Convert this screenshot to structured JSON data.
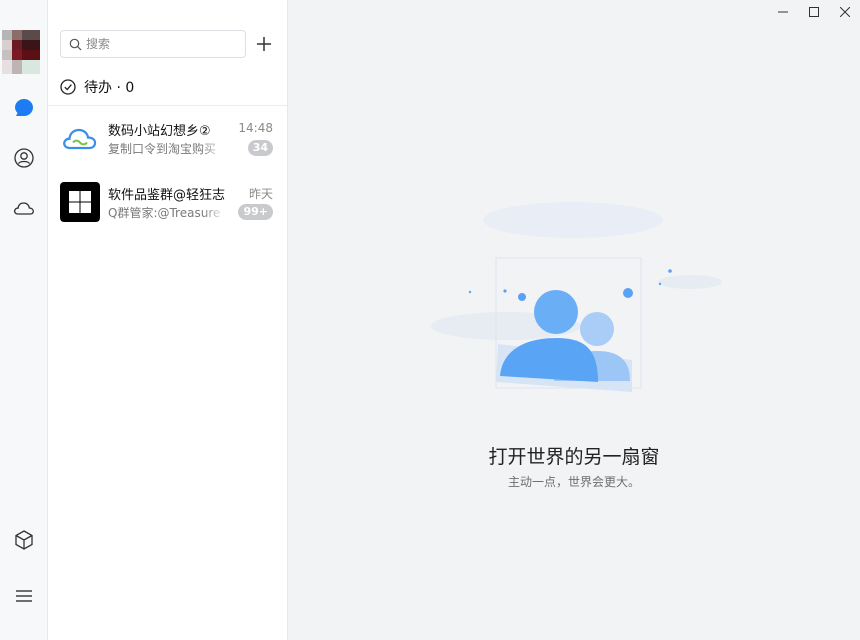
{
  "window": {
    "controls": [
      "minimize",
      "maximize",
      "close"
    ]
  },
  "rail": {
    "items": [
      {
        "icon": "chat-bubble-icon",
        "active": true
      },
      {
        "icon": "contacts-icon",
        "active": false
      },
      {
        "icon": "cloud-icon",
        "active": false
      },
      {
        "icon": "cube-icon",
        "active": false
      },
      {
        "icon": "menu-icon",
        "active": false
      }
    ]
  },
  "search": {
    "placeholder": "搜索"
  },
  "todo": {
    "label": "待办 · 0"
  },
  "conversations": [
    {
      "name": "数码小站幻想乡②",
      "time": "14:48",
      "preview": "复制口令到淘宝购买",
      "badge": "34",
      "avatar": "cloud-logo"
    },
    {
      "name": "软件品鉴群@轻狂志",
      "time": "昨天",
      "preview": "Q群管家:@Treasure",
      "badge": "99+",
      "avatar": "windows-logo"
    }
  ],
  "empty_state": {
    "title": "打开世界的另一扇窗",
    "subtitle": "主动一点，世界会更大。"
  },
  "colors": {
    "accent": "#1e7cf2",
    "badge": "#c9cacd",
    "background": "#f2f3f5"
  }
}
